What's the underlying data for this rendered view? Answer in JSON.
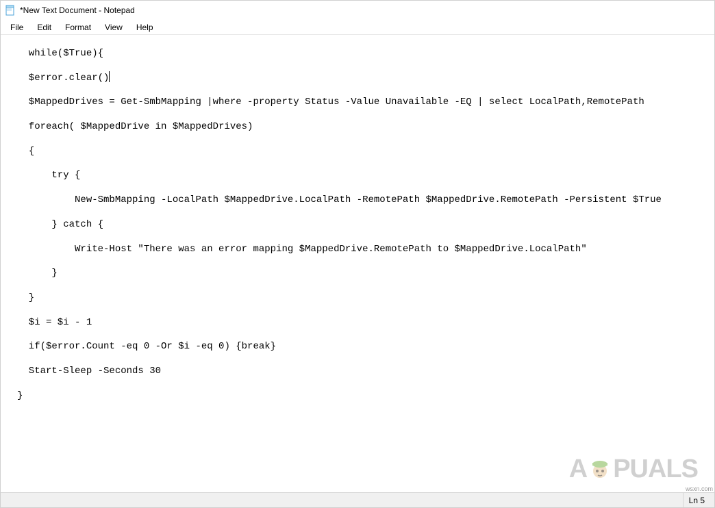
{
  "title": {
    "text": "*New Text Document - Notepad"
  },
  "menu": {
    "file": "File",
    "edit": "Edit",
    "format": "Format",
    "view": "View",
    "help": "Help"
  },
  "editor": {
    "lines": [
      "  while($True){",
      "",
      "  $error.clear()",
      "",
      "  $MappedDrives = Get-SmbMapping |where -property Status -Value Unavailable -EQ | select LocalPath,RemotePath",
      "",
      "  foreach( $MappedDrive in $MappedDrives)",
      "",
      "  {",
      "",
      "      try {",
      "",
      "          New-SmbMapping -LocalPath $MappedDrive.LocalPath -RemotePath $MappedDrive.RemotePath -Persistent $True",
      "",
      "      } catch {",
      "",
      "          Write-Host \"There was an error mapping $MappedDrive.RemotePath to $MappedDrive.LocalPath\"",
      "",
      "      }",
      "",
      "  }",
      "",
      "  $i = $i - 1",
      "",
      "  if($error.Count -eq 0 -Or $i -eq 0) {break}",
      "",
      "",
      "",
      "  Start-Sleep -Seconds 30",
      "",
      "",
      "",
      "}"
    ],
    "cursor_line_index": 2
  },
  "status": {
    "ln": "Ln 5"
  },
  "watermark": {
    "left": "A",
    "right": "PUALS"
  },
  "source": "wsxn.com"
}
